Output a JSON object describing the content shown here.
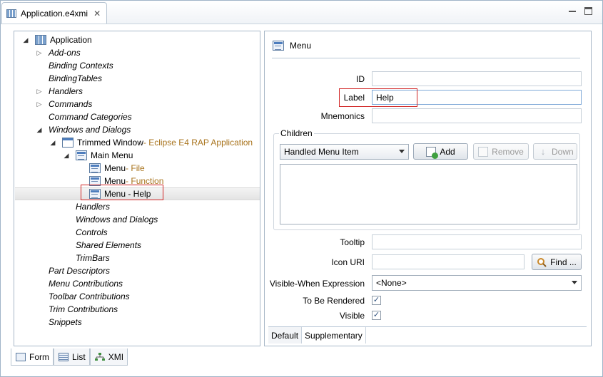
{
  "editor": {
    "tab_title": "Application.e4xmi",
    "tab_close": "✕"
  },
  "tree": {
    "items": [
      {
        "label": "Application",
        "suffix": "",
        "italic": false,
        "twisty": "open",
        "icon": "app-icon"
      },
      {
        "label": "Add-ons",
        "suffix": "",
        "italic": true,
        "twisty": "closed",
        "icon": ""
      },
      {
        "label": "Binding Contexts",
        "suffix": "",
        "italic": true,
        "twisty": "",
        "icon": ""
      },
      {
        "label": "BindingTables",
        "suffix": "",
        "italic": true,
        "twisty": "",
        "icon": ""
      },
      {
        "label": "Handlers",
        "suffix": "",
        "italic": true,
        "twisty": "closed",
        "icon": ""
      },
      {
        "label": "Commands",
        "suffix": "",
        "italic": true,
        "twisty": "closed",
        "icon": ""
      },
      {
        "label": "Command Categories",
        "suffix": "",
        "italic": true,
        "twisty": "",
        "icon": ""
      },
      {
        "label": "Windows and Dialogs",
        "suffix": "",
        "italic": true,
        "twisty": "open",
        "icon": ""
      },
      {
        "label": "Trimmed Window",
        "suffix": " - Eclipse E4 RAP Application",
        "italic": false,
        "twisty": "open",
        "icon": "window-icon"
      },
      {
        "label": "Main Menu",
        "suffix": "",
        "italic": false,
        "twisty": "open",
        "icon": "menu-icon"
      },
      {
        "label": "Menu",
        "suffix": " - File",
        "italic": false,
        "twisty": "",
        "icon": "menu-icon"
      },
      {
        "label": "Menu",
        "suffix": " - Function",
        "italic": false,
        "twisty": "",
        "icon": "menu-icon"
      },
      {
        "label": "Menu - Help",
        "suffix": "",
        "italic": false,
        "twisty": "",
        "icon": "menu-icon"
      },
      {
        "label": "Handlers",
        "suffix": "",
        "italic": true,
        "twisty": "",
        "icon": ""
      },
      {
        "label": "Windows and Dialogs",
        "suffix": "",
        "italic": true,
        "twisty": "",
        "icon": ""
      },
      {
        "label": "Controls",
        "suffix": "",
        "italic": true,
        "twisty": "",
        "icon": ""
      },
      {
        "label": "Shared Elements",
        "suffix": "",
        "italic": true,
        "twisty": "",
        "icon": ""
      },
      {
        "label": "TrimBars",
        "suffix": "",
        "italic": true,
        "twisty": "",
        "icon": ""
      },
      {
        "label": "Part Descriptors",
        "suffix": "",
        "italic": true,
        "twisty": "",
        "icon": ""
      },
      {
        "label": "Menu Contributions",
        "suffix": "",
        "italic": true,
        "twisty": "",
        "icon": ""
      },
      {
        "label": "Toolbar Contributions",
        "suffix": "",
        "italic": true,
        "twisty": "",
        "icon": ""
      },
      {
        "label": "Trim Contributions",
        "suffix": "",
        "italic": true,
        "twisty": "",
        "icon": ""
      },
      {
        "label": "Snippets",
        "suffix": "",
        "italic": true,
        "twisty": "",
        "icon": ""
      }
    ],
    "selected_index": 12
  },
  "bottom_tabs": [
    {
      "label": "Form",
      "active": true
    },
    {
      "label": "List",
      "active": false
    },
    {
      "label": "XMI",
      "active": false
    }
  ],
  "detail": {
    "heading": "Menu",
    "id_label": "ID",
    "id_value": "",
    "label_label": "Label",
    "label_value": "Help",
    "mnemonics_label": "Mnemonics",
    "mnemonics_value": "",
    "children_title": "Children",
    "children_type": "Handled Menu Item",
    "add_label": "Add",
    "remove_label": "Remove",
    "down_label": "Down",
    "tooltip_label": "Tooltip",
    "tooltip_value": "",
    "icon_uri_label": "Icon URI",
    "icon_uri_value": "",
    "find_label": "Find ...",
    "visible_when_label": "Visible-When Expression",
    "visible_when_value": "<None>",
    "to_be_rendered_label": "To Be Rendered",
    "to_be_rendered_checked": true,
    "visible_label": "Visible",
    "visible_checked": true,
    "tabs": [
      "Default",
      "Supplementary"
    ]
  },
  "colors": {
    "suffix": "#a8731c",
    "highlight_box": "#d12626",
    "border": "#a9b8c8"
  }
}
